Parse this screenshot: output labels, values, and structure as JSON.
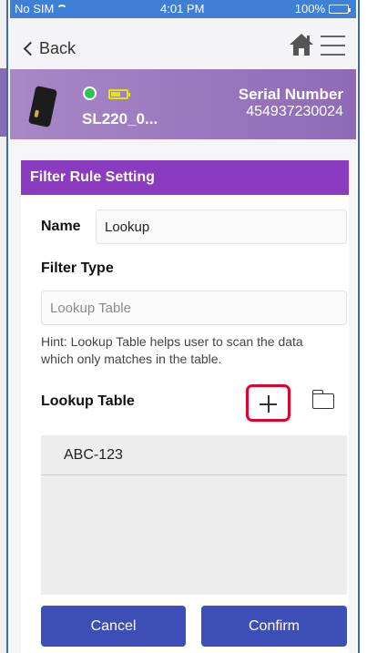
{
  "status_bar": {
    "carrier": "No SIM",
    "time": "4:01 PM",
    "battery": "100%"
  },
  "nav": {
    "back_label": "Back",
    "home_icon": "home-icon",
    "menu_icon": "hamburger-menu-icon"
  },
  "device": {
    "name": "SL220_0...",
    "serial_label": "Serial Number",
    "serial_value": "454937230024",
    "connection_color": "#2ec452",
    "battery_color": "#e6e600"
  },
  "panel": {
    "title": "Filter Rule Setting",
    "name_label": "Name",
    "name_value": "Lookup",
    "filter_type_label": "Filter Type",
    "filter_type_value": "Lookup Table",
    "hint": "Hint: Lookup Table helps user to scan the data which only matches in the table.",
    "lookup_table_label": "Lookup Table",
    "lookup_items": [
      "ABC-123"
    ]
  },
  "buttons": {
    "cancel": "Cancel",
    "confirm": "Confirm"
  },
  "colors": {
    "status_bar": "#3f7fd6",
    "header_purple": "#8b3bbf",
    "button_blue": "#3d4fb6",
    "highlight_red": "#e4002b"
  }
}
